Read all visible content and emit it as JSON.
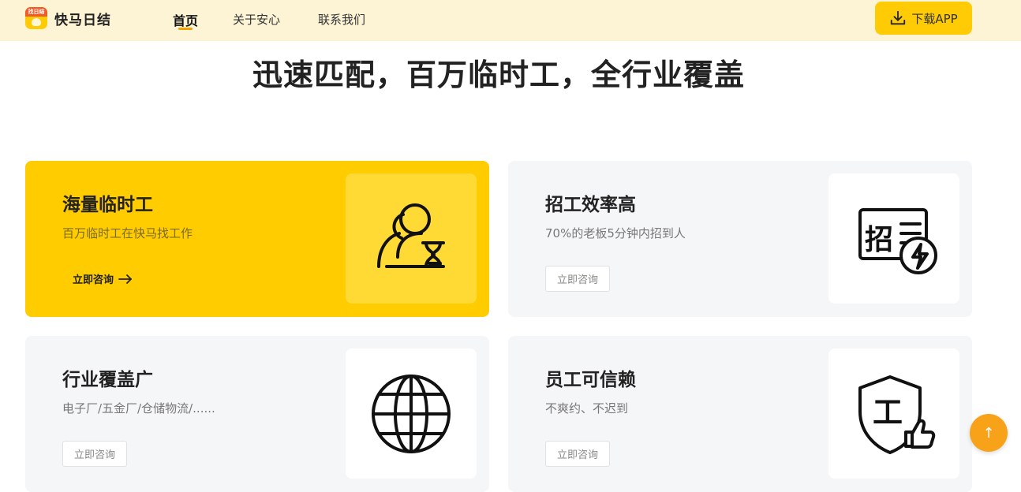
{
  "header": {
    "logo_text": "找日结",
    "brand": "快马日结",
    "nav": [
      "首页",
      "关于安心",
      "联系我们"
    ],
    "download_label": "下载APP"
  },
  "hero": {
    "title": "迅速匹配，百万临时工，全行业覆盖"
  },
  "cards": [
    {
      "title": "海量临时工",
      "desc": "百万临时工在快马找工作",
      "cta": "立即咨询",
      "icon": "worker-hourglass-icon"
    },
    {
      "title": "招工效率高",
      "desc": "70%的老板5分钟内招到人",
      "cta": "立即咨询",
      "icon": "recruit-lightning-icon",
      "icon_text": "招"
    },
    {
      "title": "行业覆盖广",
      "desc": "电子厂/五金厂/仓储物流/......",
      "cta": "立即咨询",
      "icon": "globe-icon"
    },
    {
      "title": "员工可信赖",
      "desc": "不爽约、不迟到",
      "cta": "立即咨询",
      "icon": "shield-thumbsup-icon",
      "icon_text": "工"
    }
  ],
  "scroll_top": "↑",
  "colors": {
    "accent": "#ffcc00",
    "header_bg": "#fdf4d6",
    "scroll_btn": "#f8a21a"
  }
}
